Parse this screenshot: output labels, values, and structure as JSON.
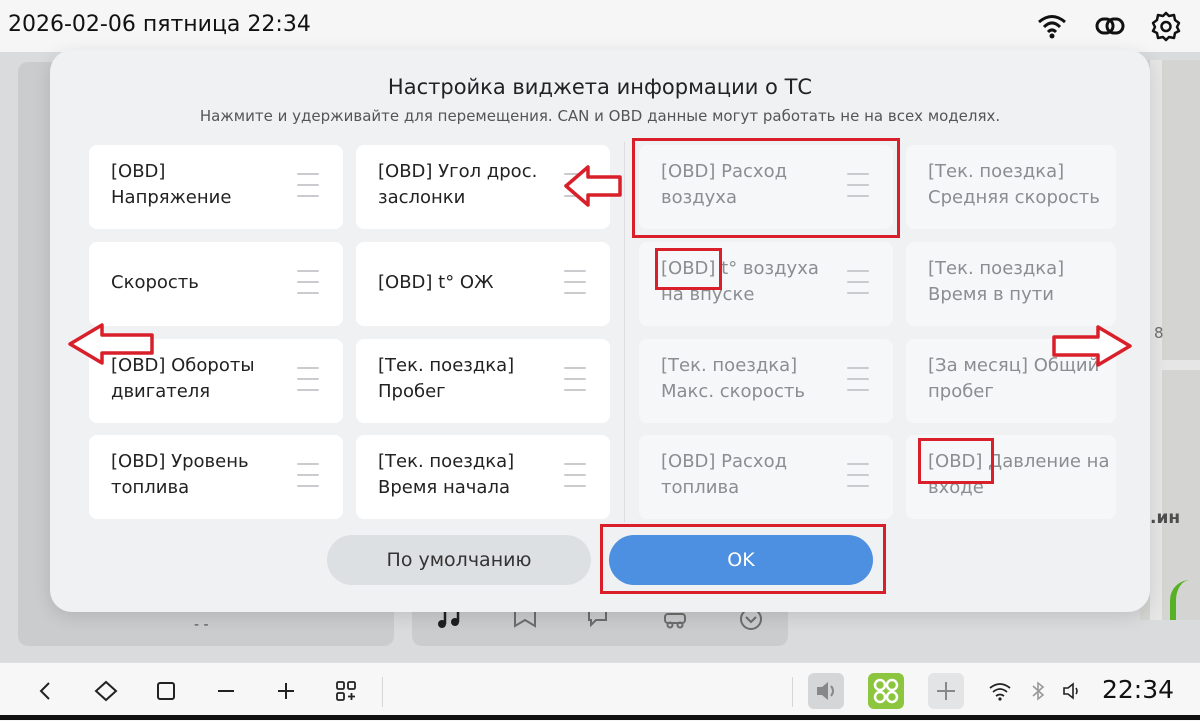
{
  "statusbar": {
    "datetime": "2026-02-06 пятница 22:34"
  },
  "dialog": {
    "title": "Настройка виджета информации о ТС",
    "subtitle": "Нажмите и удерживайте для перемещения. CAN и OBD данные могут работать не на всех моделях.",
    "active_tiles": [
      {
        "label": "[OBD] Напряжение"
      },
      {
        "label": "[OBD] Угол дрос. заслонки"
      },
      {
        "label": "Скорость"
      },
      {
        "label": "[OBD] t° ОЖ"
      },
      {
        "label": "[OBD] Обороты двигателя"
      },
      {
        "label": "[Тек. поездка] Пробег"
      },
      {
        "label": "[OBD] Уровень топлива"
      },
      {
        "label": "[Тек. поездка] Время начала"
      }
    ],
    "inactive_tiles": [
      {
        "label": "[OBD] Расход воздуха"
      },
      {
        "label": "[Тек. поездка] Средняя скорость"
      },
      {
        "label": "[OBD] t° воздуха на впуске"
      },
      {
        "label": "[Тек. поездка] Время в пути"
      },
      {
        "label": "[Тек. поездка] Макс. скорость"
      },
      {
        "label": "[За месяц] Общий пробег"
      },
      {
        "label": "[OBD] Расход топлива"
      },
      {
        "label": "[OBD] Давление на входе"
      }
    ],
    "default_button": "По умолчанию",
    "ok_button": "OK"
  },
  "background": {
    "map_label_fragment": ".ин",
    "map_number": "8",
    "left_card_fragment": "- -"
  },
  "navbar": {
    "clock": "22:34"
  },
  "colors": {
    "accent": "#4d8fe0",
    "annotation": "#d9202a",
    "app_tile_green": "#8cc63f"
  }
}
